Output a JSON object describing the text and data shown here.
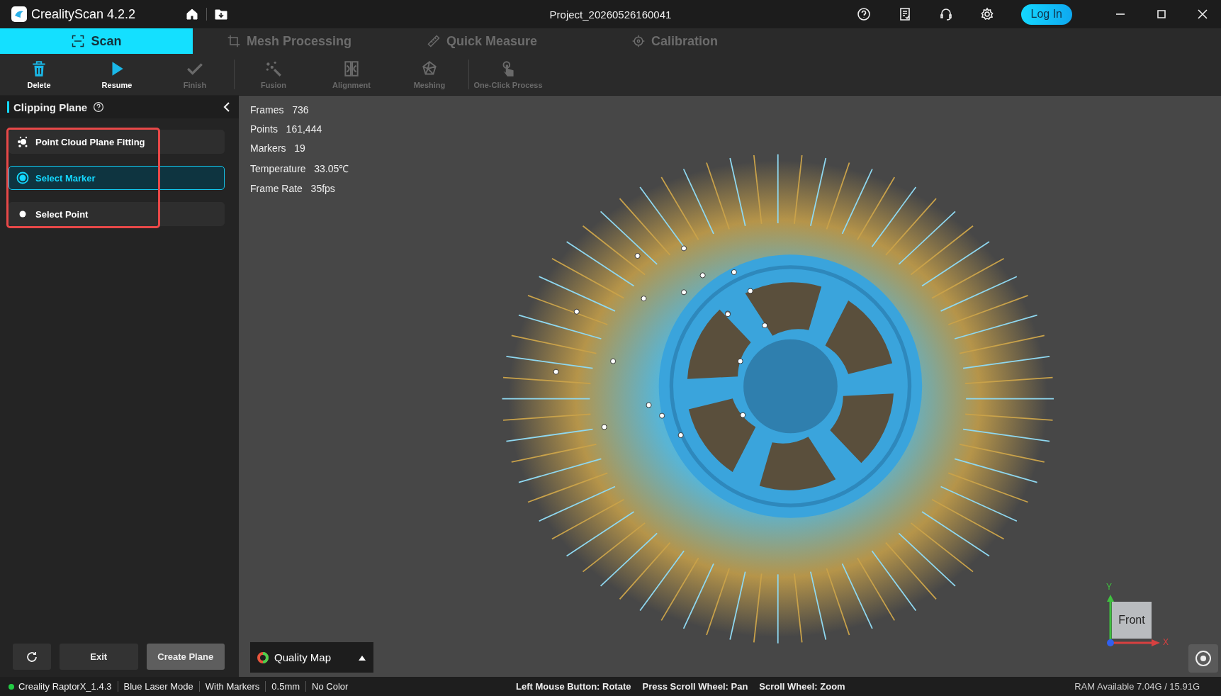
{
  "titlebar": {
    "app_name": "CrealityScan 4.2.2",
    "project": "Project_20260526160041",
    "login": "Log In"
  },
  "tabs": [
    {
      "label": "Scan",
      "selected": true
    },
    {
      "label": "Mesh Processing",
      "selected": false
    },
    {
      "label": "Quick Measure",
      "selected": false
    },
    {
      "label": "Calibration",
      "selected": false
    }
  ],
  "toolbar": [
    {
      "label": "Delete",
      "disabled": false
    },
    {
      "label": "Resume",
      "disabled": false
    },
    {
      "label": "Finish",
      "disabled": true
    },
    {
      "label": "Fusion",
      "disabled": true
    },
    {
      "label": "Alignment",
      "disabled": true
    },
    {
      "label": "Meshing",
      "disabled": true
    },
    {
      "label": "One-Click Process",
      "disabled": true
    }
  ],
  "panel": {
    "title": "Clipping Plane",
    "options": [
      {
        "label": "Point Cloud Plane Fitting",
        "kind": "action",
        "selected": false
      },
      {
        "label": "Select Marker",
        "kind": "radio",
        "selected": true
      },
      {
        "label": "Select Point",
        "kind": "radio",
        "selected": false
      }
    ],
    "buttons": [
      "Exit",
      "Create Plane"
    ]
  },
  "stats": [
    {
      "label": "Frames",
      "value": "736"
    },
    {
      "label": "Points",
      "value": "161,444"
    },
    {
      "label": "Markers",
      "value": "19"
    },
    {
      "label": "Temperature",
      "value": "33.05℃"
    },
    {
      "label": "Frame Rate",
      "value": "35fps"
    }
  ],
  "quality_map": {
    "label": "Quality Map"
  },
  "view_cube": {
    "face": "Front",
    "x_label": "X",
    "y_label": "Y"
  },
  "status_bar": {
    "items": [
      "Creality RaptorX_1.4.3",
      "Blue Laser Mode",
      "With Markers",
      "0.5mm",
      "No Color"
    ],
    "hints": [
      "Left Mouse Button: Rotate",
      "Press Scroll Wheel: Pan",
      "Scroll Wheel: Zoom"
    ],
    "ram": "RAM Available 7.04G / 15.91G"
  }
}
